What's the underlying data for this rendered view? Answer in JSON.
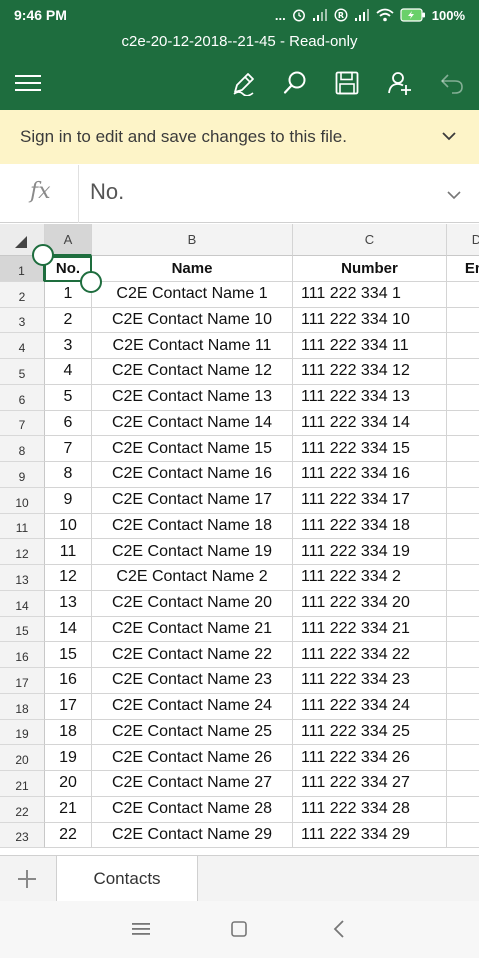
{
  "status": {
    "time": "9:46 PM",
    "dots": "...",
    "battery": "100%"
  },
  "title": "c2e-20-12-2018--21-45 - Read-only",
  "banner": {
    "text": "Sign in to edit and save changes to this file."
  },
  "formula": {
    "label": "fx",
    "value": "No."
  },
  "columns": [
    "A",
    "B",
    "C",
    "D"
  ],
  "rows": [
    {
      "n": "1",
      "no": "No.",
      "name": "Name",
      "number": "Number",
      "d": "Em"
    },
    {
      "n": "2",
      "no": "1",
      "name": "C2E Contact Name 1",
      "number": "111 222 334 1",
      "d": ""
    },
    {
      "n": "3",
      "no": "2",
      "name": "C2E Contact Name 10",
      "number": "111 222 334 10",
      "d": ""
    },
    {
      "n": "4",
      "no": "3",
      "name": "C2E Contact Name 11",
      "number": "111 222 334 11",
      "d": ""
    },
    {
      "n": "5",
      "no": "4",
      "name": "C2E Contact Name 12",
      "number": "111 222 334 12",
      "d": ""
    },
    {
      "n": "6",
      "no": "5",
      "name": "C2E Contact Name 13",
      "number": "111 222 334 13",
      "d": ""
    },
    {
      "n": "7",
      "no": "6",
      "name": "C2E Contact Name 14",
      "number": "111 222 334 14",
      "d": ""
    },
    {
      "n": "8",
      "no": "7",
      "name": "C2E Contact Name 15",
      "number": "111 222 334 15",
      "d": ""
    },
    {
      "n": "9",
      "no": "8",
      "name": "C2E Contact Name 16",
      "number": "111 222 334 16",
      "d": ""
    },
    {
      "n": "10",
      "no": "9",
      "name": "C2E Contact Name 17",
      "number": "111 222 334 17",
      "d": ""
    },
    {
      "n": "11",
      "no": "10",
      "name": "C2E Contact Name 18",
      "number": "111 222 334 18",
      "d": ""
    },
    {
      "n": "12",
      "no": "11",
      "name": "C2E Contact Name 19",
      "number": "111 222 334 19",
      "d": ""
    },
    {
      "n": "13",
      "no": "12",
      "name": "C2E Contact Name 2",
      "number": "111 222 334 2",
      "d": ""
    },
    {
      "n": "14",
      "no": "13",
      "name": "C2E Contact Name 20",
      "number": "111 222 334 20",
      "d": ""
    },
    {
      "n": "15",
      "no": "14",
      "name": "C2E Contact Name 21",
      "number": "111 222 334 21",
      "d": ""
    },
    {
      "n": "16",
      "no": "15",
      "name": "C2E Contact Name 22",
      "number": "111 222 334 22",
      "d": ""
    },
    {
      "n": "17",
      "no": "16",
      "name": "C2E Contact Name 23",
      "number": "111 222 334 23",
      "d": ""
    },
    {
      "n": "18",
      "no": "17",
      "name": "C2E Contact Name 24",
      "number": "111 222 334 24",
      "d": ""
    },
    {
      "n": "19",
      "no": "18",
      "name": "C2E Contact Name 25",
      "number": "111 222 334 25",
      "d": ""
    },
    {
      "n": "20",
      "no": "19",
      "name": "C2E Contact Name 26",
      "number": "111 222 334 26",
      "d": ""
    },
    {
      "n": "21",
      "no": "20",
      "name": "C2E Contact Name 27",
      "number": "111 222 334 27",
      "d": ""
    },
    {
      "n": "22",
      "no": "21",
      "name": "C2E Contact Name 28",
      "number": "111 222 334 28",
      "d": ""
    },
    {
      "n": "23",
      "no": "22",
      "name": "C2E Contact Name 29",
      "number": "111 222 334 29",
      "d": ""
    }
  ],
  "sheet_tabs": [
    "Contacts"
  ],
  "icons": {
    "menu": "hamburger-icon",
    "edit": "pen-icon",
    "search": "search-icon",
    "save": "save-icon",
    "share": "add-person-icon",
    "undo": "undo-icon"
  },
  "colors": {
    "brand": "#1e6d3e",
    "banner": "#fdf4c8"
  }
}
